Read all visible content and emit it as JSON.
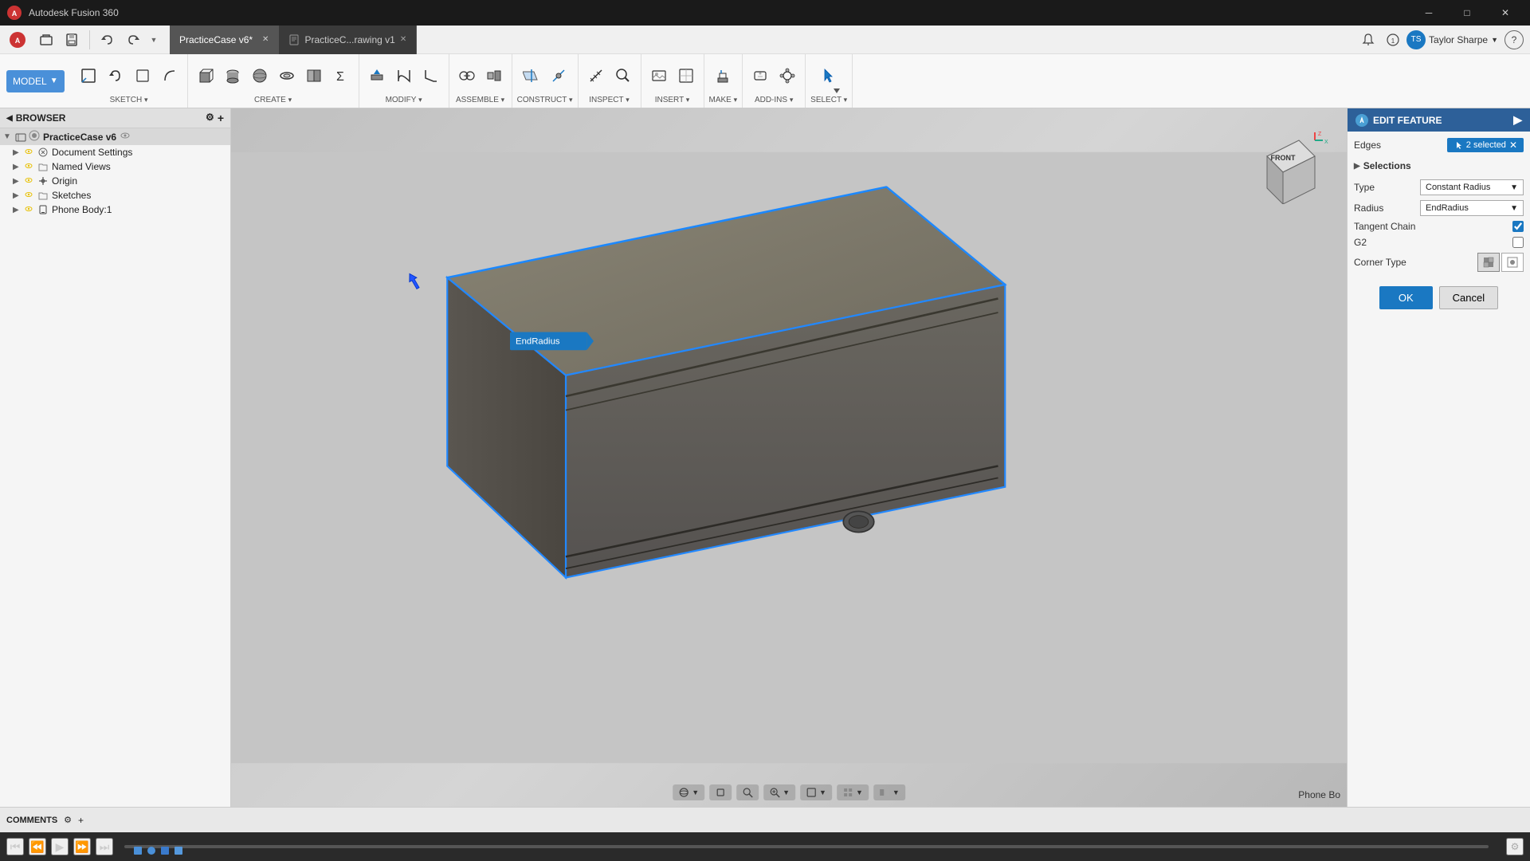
{
  "app": {
    "title": "Autodesk Fusion 360",
    "logo": "A"
  },
  "titlebar": {
    "title": "Autodesk Fusion 360",
    "minimize": "─",
    "maximize": "□",
    "close": "✕"
  },
  "tabs": [
    {
      "label": "PracticeCase v6*",
      "active": true,
      "modified": "*"
    },
    {
      "label": "PracticeC...rawing v1",
      "active": false
    }
  ],
  "toolbar": {
    "model_label": "MODEL",
    "groups": [
      {
        "name": "sketch",
        "label": "SKETCH",
        "icons": [
          "✏️",
          "↩",
          "⬜",
          "⌒"
        ]
      },
      {
        "name": "create",
        "label": "CREATE",
        "icons": [
          "⬛",
          "◭",
          "⬡",
          "⌬",
          "▣",
          "∑"
        ]
      },
      {
        "name": "modify",
        "label": "MODIFY",
        "icons": [
          "🔧",
          "⬛",
          "⊕"
        ]
      },
      {
        "name": "assemble",
        "label": "ASSEMBLE",
        "icons": [
          "🔗",
          "⚙"
        ]
      },
      {
        "name": "construct",
        "label": "CONSTRUCT",
        "icons": [
          "✦",
          "◻"
        ]
      },
      {
        "name": "inspect",
        "label": "INSPECT",
        "icons": [
          "🔍",
          "📏"
        ]
      },
      {
        "name": "insert",
        "label": "INSERT",
        "icons": [
          "📸",
          "🖼"
        ]
      },
      {
        "name": "make",
        "label": "MAKE",
        "icons": [
          "🖨"
        ]
      },
      {
        "name": "addins",
        "label": "ADD-INS",
        "icons": [
          "🔌",
          "⚙"
        ]
      },
      {
        "name": "select",
        "label": "SELECT",
        "icons": [
          "↖",
          "⬇"
        ]
      }
    ]
  },
  "browser": {
    "title": "BROWSER",
    "items": [
      {
        "label": "PracticeCase v6",
        "level": 0,
        "type": "root",
        "expanded": true
      },
      {
        "label": "Document Settings",
        "level": 1,
        "type": "settings",
        "expanded": false
      },
      {
        "label": "Named Views",
        "level": 1,
        "type": "folder",
        "expanded": false
      },
      {
        "label": "Origin",
        "level": 1,
        "type": "origin",
        "expanded": false
      },
      {
        "label": "Sketches",
        "level": 1,
        "type": "folder",
        "expanded": false
      },
      {
        "label": "Phone Body:1",
        "level": 1,
        "type": "body",
        "expanded": false
      }
    ]
  },
  "edit_feature": {
    "title": "EDIT FEATURE",
    "edges_label": "Edges",
    "edges_value": "2 selected",
    "selections_label": "Selections",
    "type_label": "Type",
    "type_value": "Constant Radius",
    "radius_label": "Radius",
    "radius_value": "EndRadius",
    "tangent_chain_label": "Tangent Chain",
    "tangent_chain_checked": true,
    "g2_label": "G2",
    "g2_checked": false,
    "corner_type_label": "Corner Type",
    "ok_label": "OK",
    "cancel_label": "Cancel"
  },
  "input_tooltip": {
    "value": "EndRadius",
    "placeholder": "EndRadius"
  },
  "bottom": {
    "comments_label": "COMMENTS",
    "status_right": "Phone Bo"
  },
  "nav_cube": {
    "face": "FRONT"
  }
}
